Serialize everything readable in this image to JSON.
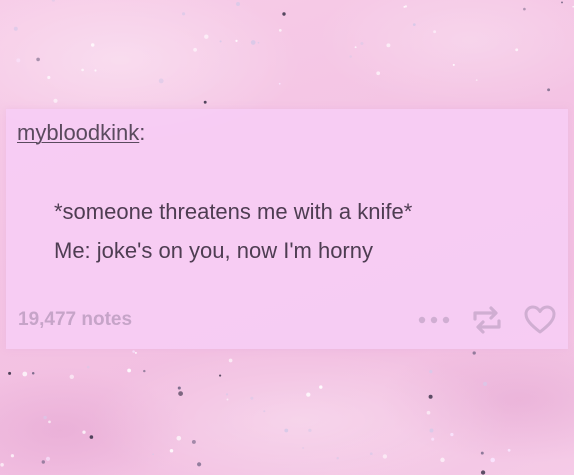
{
  "post": {
    "username": "mybloodkink",
    "username_suffix": ":",
    "lines": [
      "*someone threatens me with a knife*",
      "Me: joke's on you, now I'm horny"
    ],
    "notes": "19,477 notes"
  },
  "icons": {
    "more": "more-dots-icon",
    "reblog": "reblog-icon",
    "like": "heart-icon"
  },
  "colors": {
    "card_background": "#f6ccf4",
    "text": "#4e3d52",
    "muted": "#c6a4c8",
    "background_pink": "#f4c4e4"
  }
}
